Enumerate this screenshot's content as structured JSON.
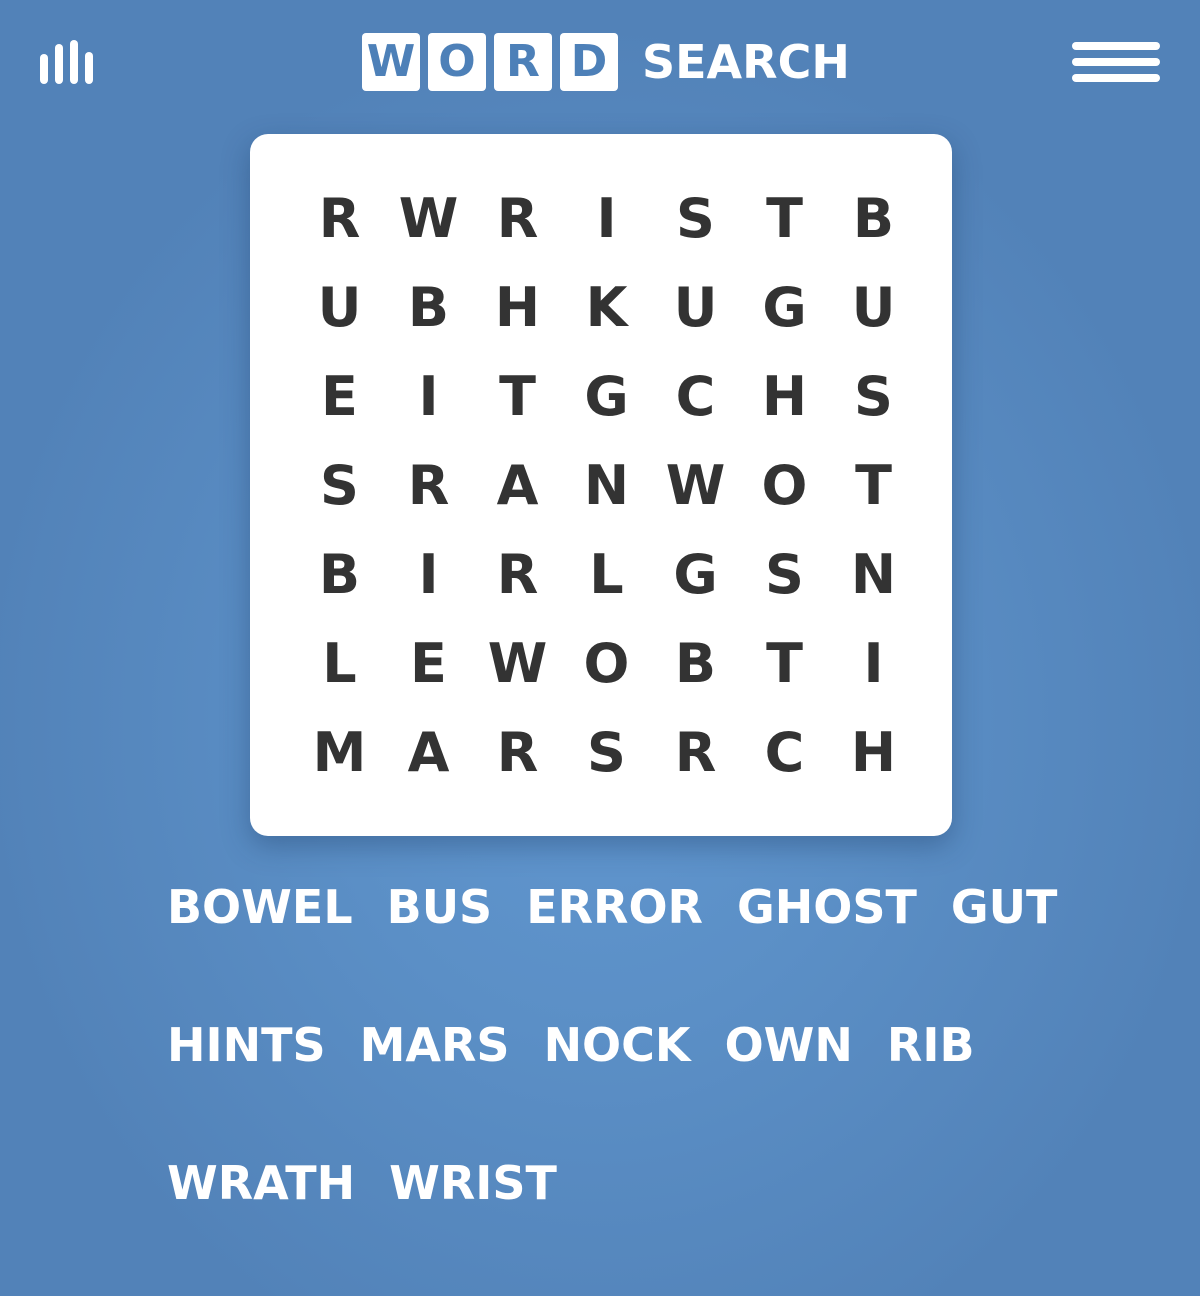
{
  "header": {
    "logo_tiles": [
      "W",
      "O",
      "R",
      "D"
    ],
    "logo_word": "SEARCH",
    "left_icon": "stats-icon",
    "right_icon": "menu-icon"
  },
  "grid": {
    "rows": [
      [
        "R",
        "W",
        "R",
        "I",
        "S",
        "T",
        "B"
      ],
      [
        "U",
        "B",
        "H",
        "K",
        "U",
        "G",
        "U"
      ],
      [
        "E",
        "I",
        "T",
        "G",
        "C",
        "H",
        "S"
      ],
      [
        "S",
        "R",
        "A",
        "N",
        "W",
        "O",
        "T"
      ],
      [
        "B",
        "I",
        "R",
        "L",
        "G",
        "S",
        "N"
      ],
      [
        "L",
        "E",
        "W",
        "O",
        "B",
        "T",
        "I"
      ],
      [
        "M",
        "A",
        "R",
        "S",
        "R",
        "C",
        "H"
      ]
    ]
  },
  "words": {
    "lines": [
      [
        "BOWEL",
        "BUS",
        "ERROR",
        "GHOST",
        "GUT"
      ],
      [
        "HINTS",
        "MARS",
        "NOCK",
        "OWN",
        "RIB"
      ],
      [
        "WRATH",
        "WRIST"
      ]
    ]
  },
  "colors": {
    "background": "#5b8fc6",
    "card": "#ffffff",
    "letter": "#333333",
    "logo_accent": "#4d80b8"
  }
}
